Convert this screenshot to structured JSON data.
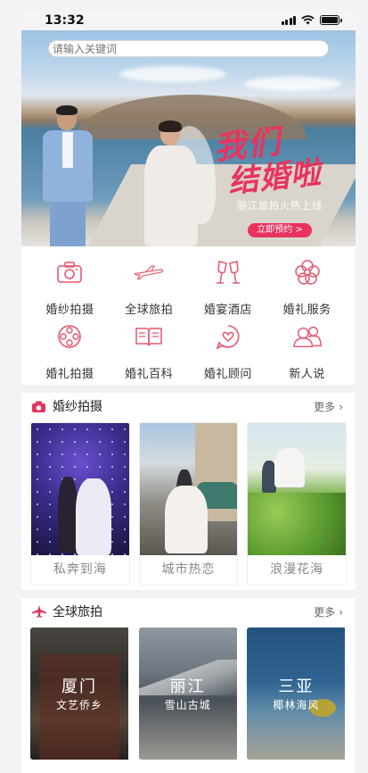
{
  "status_bar": {
    "time": "13:32"
  },
  "banner": {
    "search_placeholder": "请输入关键词",
    "title_line1": "我们",
    "title_line2": "结婚啦",
    "subtitle": "丽江旅拍火热上线",
    "button_label": "立即预约 >"
  },
  "categories": [
    {
      "label": "婚纱拍摄",
      "icon": "camera-icon"
    },
    {
      "label": "全球旅拍",
      "icon": "airplane-icon"
    },
    {
      "label": "婚宴酒店",
      "icon": "champagne-glasses-icon"
    },
    {
      "label": "婚礼服务",
      "icon": "flower-icon"
    },
    {
      "label": "婚礼拍摄",
      "icon": "film-reel-icon"
    },
    {
      "label": "婚礼百科",
      "icon": "open-book-icon"
    },
    {
      "label": "婚礼顾问",
      "icon": "heart-chat-icon"
    },
    {
      "label": "新人说",
      "icon": "couple-icon"
    }
  ],
  "wedding_photo": {
    "title": "婚纱拍摄",
    "more": "更多",
    "items": [
      {
        "caption": "私奔到海"
      },
      {
        "caption": "城市热恋"
      },
      {
        "caption": "浪漫花海"
      }
    ]
  },
  "global_travel": {
    "title": "全球旅拍",
    "more": "更多",
    "items": [
      {
        "city": "厦门",
        "sub": "文艺侨乡"
      },
      {
        "city": "丽江",
        "sub": "雪山古城"
      },
      {
        "city": "三亚",
        "sub": "椰林海风"
      }
    ]
  },
  "colors": {
    "accent": "#e8335e",
    "icon_pink": "#e5566f"
  }
}
